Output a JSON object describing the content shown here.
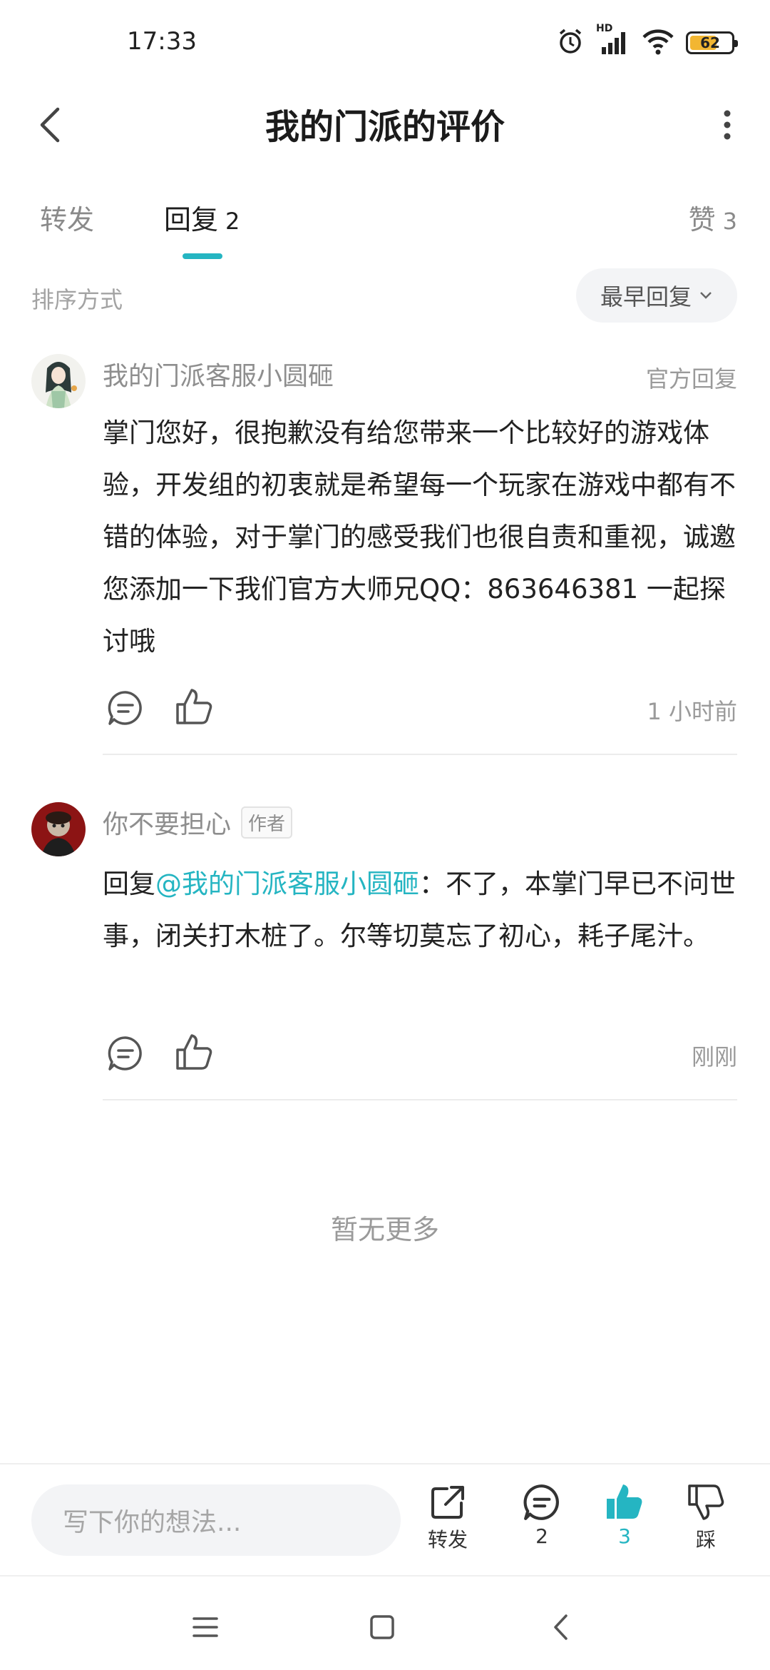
{
  "status_bar": {
    "time": "17:33",
    "network_label": "HD",
    "battery_level": "62"
  },
  "header": {
    "title": "我的门派的评价"
  },
  "tabs": [
    {
      "label": "转发",
      "count": ""
    },
    {
      "label": "回复",
      "count": "2"
    },
    {
      "label": "赞",
      "count": "3"
    }
  ],
  "sort": {
    "label": "排序方式",
    "value": "最早回复"
  },
  "comments": [
    {
      "author": "我的门派客服小圆砸",
      "badge": "官方回复",
      "text": "掌门您好，很抱歉没有给您带来一个比较好的游戏体验，开发组的初衷就是希望每一个玩家在游戏中都有不错的体验，对于掌门的感受我们也很自责和重视，诚邀您添加一下我们官方大师兄QQ：863646381 一起探讨哦",
      "time": "1 小时前"
    },
    {
      "author": "你不要担心",
      "tag": "作者",
      "reply_prefix": "回复",
      "mention": "@我的门派客服小圆砸",
      "text": "：不了，本掌门早已不问世事，闭关打木桩了。尔等切莫忘了初心，耗子尾汁。",
      "time": "刚刚"
    }
  ],
  "footer_note": "暂无更多",
  "bottom_bar": {
    "input_placeholder": "写下你的想法...",
    "share_label": "转发",
    "comment_count": "2",
    "like_count": "3",
    "dislike_label": "踩"
  },
  "colors": {
    "accent": "#25b5c2",
    "battery": "#f2b632"
  }
}
